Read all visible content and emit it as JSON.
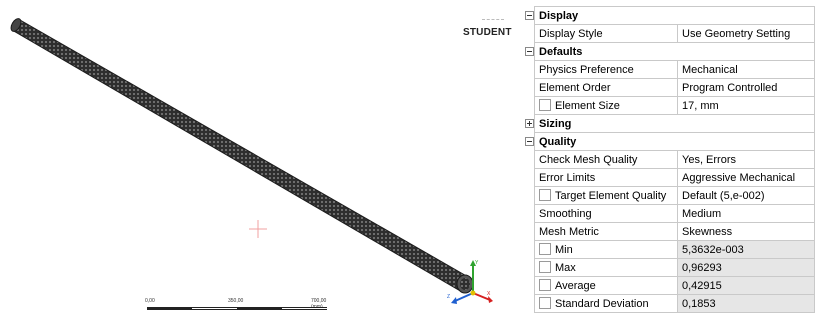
{
  "viewport": {
    "student_label": "STUDENT",
    "scale": {
      "labels": [
        "0,00",
        "350,00",
        "700,00 (mm)"
      ]
    },
    "triad": {
      "y_label": "Y",
      "x_label": "X",
      "z_label": "Z"
    }
  },
  "properties": {
    "display": {
      "title": "Display",
      "expanded": true,
      "rows": [
        {
          "name": "Display Style",
          "value": "Use Geometry Setting"
        }
      ]
    },
    "defaults": {
      "title": "Defaults",
      "expanded": true,
      "rows": [
        {
          "name": "Physics Preference",
          "value": "Mechanical"
        },
        {
          "name": "Element Order",
          "value": "Program Controlled"
        },
        {
          "name": "Element Size",
          "value": "17, mm",
          "checkbox": true
        }
      ]
    },
    "sizing": {
      "title": "Sizing",
      "expanded": false
    },
    "quality": {
      "title": "Quality",
      "expanded": true,
      "rows": [
        {
          "name": "Check Mesh Quality",
          "value": "Yes, Errors"
        },
        {
          "name": "Error Limits",
          "value": "Aggressive Mechanical"
        },
        {
          "name": "Target Element Quality",
          "value": "Default (5,e-002)",
          "checkbox": true
        },
        {
          "name": "Smoothing",
          "value": "Medium"
        },
        {
          "name": "Mesh Metric",
          "value": "Skewness"
        },
        {
          "name": "Min",
          "value": "5,3632e-003",
          "checkbox": true,
          "readonly": true
        },
        {
          "name": "Max",
          "value": "0,96293",
          "checkbox": true,
          "readonly": true
        },
        {
          "name": "Average",
          "value": "0,42915",
          "checkbox": true,
          "readonly": true
        },
        {
          "name": "Standard Deviation",
          "value": "0,1853",
          "checkbox": true,
          "readonly": true
        }
      ]
    }
  },
  "colors": {
    "mesh": "#2b2b2b",
    "grid_border": "#c9c9c9",
    "readonly_bg": "#e6e6e6",
    "axis_x": "#d62020",
    "axis_y": "#2fa32f",
    "axis_z": "#1f5fd0",
    "probe": "#f2a0a0"
  }
}
